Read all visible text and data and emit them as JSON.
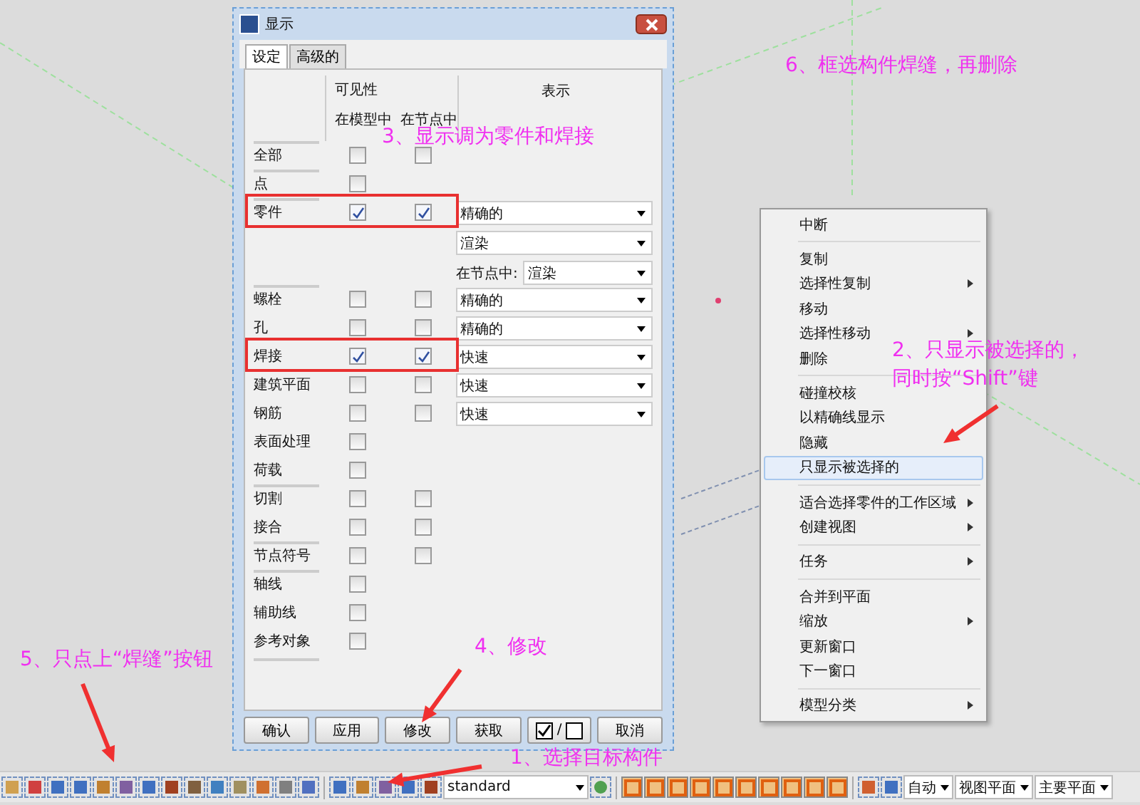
{
  "dialog": {
    "title": "显示",
    "tabs": [
      {
        "label": "设定",
        "selected": true
      },
      {
        "label": "高级的",
        "selected": false
      }
    ],
    "headers": {
      "visibility": "可见性",
      "in_model": "在模型中",
      "in_node": "在节点中",
      "display": "表示"
    },
    "rows": [
      {
        "label": "全部",
        "divider_above": true,
        "model": false,
        "node": false,
        "highlighted": false,
        "display": []
      },
      {
        "label": "点",
        "divider_above": true,
        "model": false,
        "highlighted": false,
        "display": []
      },
      {
        "label": "零件",
        "divider_above": true,
        "model": true,
        "node": true,
        "highlighted": true,
        "display": [
          {
            "value": "精确的"
          },
          {
            "value": "渲染"
          },
          {
            "label": "在节点中:",
            "value": "渲染"
          }
        ]
      },
      {
        "label": "螺栓",
        "divider_above": true,
        "model": false,
        "node": false,
        "highlighted": false,
        "display": [
          {
            "value": "精确的"
          }
        ]
      },
      {
        "label": "孔",
        "divider_above": false,
        "model": false,
        "node": false,
        "highlighted": false,
        "display": [
          {
            "value": "精确的"
          }
        ]
      },
      {
        "label": "焊接",
        "divider_above": false,
        "model": true,
        "node": true,
        "highlighted": true,
        "display": [
          {
            "value": "快速"
          }
        ]
      },
      {
        "label": "建筑平面",
        "divider_above": false,
        "model": false,
        "node": false,
        "highlighted": false,
        "display": [
          {
            "value": "快速"
          }
        ]
      },
      {
        "label": "钢筋",
        "divider_above": false,
        "model": false,
        "node": false,
        "highlighted": false,
        "display": [
          {
            "value": "快速"
          }
        ]
      },
      {
        "label": "表面处理",
        "divider_above": false,
        "model": false,
        "highlighted": false,
        "display": []
      },
      {
        "label": "荷载",
        "divider_above": false,
        "model": false,
        "highlighted": false,
        "display": []
      },
      {
        "label": "切割",
        "divider_above": true,
        "model": false,
        "node": false,
        "highlighted": false,
        "display": []
      },
      {
        "label": "接合",
        "divider_above": false,
        "model": false,
        "node": false,
        "highlighted": false,
        "display": []
      },
      {
        "label": "节点符号",
        "divider_above": true,
        "model": false,
        "node": false,
        "highlighted": false,
        "display": []
      },
      {
        "label": "轴线",
        "divider_above": true,
        "model": false,
        "highlighted": false,
        "display": []
      },
      {
        "label": "辅助线",
        "divider_above": false,
        "model": false,
        "highlighted": false,
        "display": []
      },
      {
        "label": "参考对象",
        "divider_above": false,
        "model": false,
        "highlighted": false,
        "display": []
      }
    ],
    "buttons": [
      {
        "kind": "text",
        "label": "确认"
      },
      {
        "kind": "text",
        "label": "应用"
      },
      {
        "kind": "text",
        "label": "修改"
      },
      {
        "kind": "text",
        "label": "获取"
      },
      {
        "kind": "toggle",
        "label": "/"
      },
      {
        "kind": "text",
        "label": "取消"
      }
    ]
  },
  "context_menu": {
    "groups": [
      [
        {
          "label": "中断",
          "submenu": false,
          "selected": false
        }
      ],
      [
        {
          "label": "复制",
          "submenu": false,
          "selected": false
        },
        {
          "label": "选择性复制",
          "submenu": true,
          "selected": false
        },
        {
          "label": "移动",
          "submenu": false,
          "selected": false
        },
        {
          "label": "选择性移动",
          "submenu": true,
          "selected": false
        },
        {
          "label": "删除",
          "submenu": false,
          "selected": false
        }
      ],
      [
        {
          "label": "碰撞校核",
          "submenu": false,
          "selected": false
        },
        {
          "label": "以精确线显示",
          "submenu": false,
          "selected": false
        },
        {
          "label": "隐藏",
          "submenu": false,
          "selected": false
        },
        {
          "label": "只显示被选择的",
          "submenu": false,
          "selected": true
        }
      ],
      [
        {
          "label": "适合选择零件的工作区域",
          "submenu": true,
          "selected": false
        },
        {
          "label": "创建视图",
          "submenu": true,
          "selected": false
        }
      ],
      [
        {
          "label": "任务",
          "submenu": true,
          "selected": false
        }
      ],
      [
        {
          "label": "合并到平面",
          "submenu": false,
          "selected": false
        },
        {
          "label": "缩放",
          "submenu": true,
          "selected": false
        },
        {
          "label": "更新窗口",
          "submenu": false,
          "selected": false
        },
        {
          "label": "下一窗口",
          "submenu": false,
          "selected": false
        }
      ],
      [
        {
          "label": "模型分类",
          "submenu": true,
          "selected": false
        }
      ]
    ]
  },
  "toolbar": {
    "dropdowns": [
      {
        "value": "standard"
      },
      {
        "value": "自动"
      },
      {
        "value": "视图平面"
      },
      {
        "value": "主要平面"
      }
    ]
  },
  "annotations": [
    {
      "lines": [
        "1、选择目标构件"
      ]
    },
    {
      "lines": [
        "2、只显示被选择的，",
        "同时按“Shift”键"
      ]
    },
    {
      "lines": [
        "3、显示调为零件和焊接"
      ]
    },
    {
      "lines": [
        "4、修改"
      ]
    },
    {
      "lines": [
        "5、只点上“焊缝”按钮"
      ]
    },
    {
      "lines": [
        "6、框选构件焊缝，再删除"
      ]
    }
  ]
}
